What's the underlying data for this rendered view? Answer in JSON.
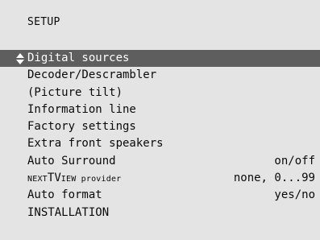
{
  "title": "SETUP",
  "selected_index": 0,
  "icons": {
    "selection": "up-down-arrows-icon"
  },
  "colors": {
    "background": "#e4e4e4",
    "highlight": "#5e5e5e",
    "text": "#0a0a0a",
    "highlight_text": "#ffffff"
  },
  "items": [
    {
      "label": "Digital sources",
      "value": ""
    },
    {
      "label": "Decoder/Descrambler",
      "value": ""
    },
    {
      "label": "(Picture tilt)",
      "value": ""
    },
    {
      "label": "Information line",
      "value": ""
    },
    {
      "label": "Factory settings",
      "value": ""
    },
    {
      "label": "Extra front speakers",
      "value": ""
    },
    {
      "label": "Auto Surround",
      "value": "on/off"
    },
    {
      "label_prefix": "NEXT",
      "label_brand": "TV",
      "label_suffix": "IEW provider",
      "value": "none, 0...99"
    },
    {
      "label": "Auto format",
      "value": "yes/no"
    },
    {
      "label": "INSTALLATION",
      "value": ""
    }
  ]
}
